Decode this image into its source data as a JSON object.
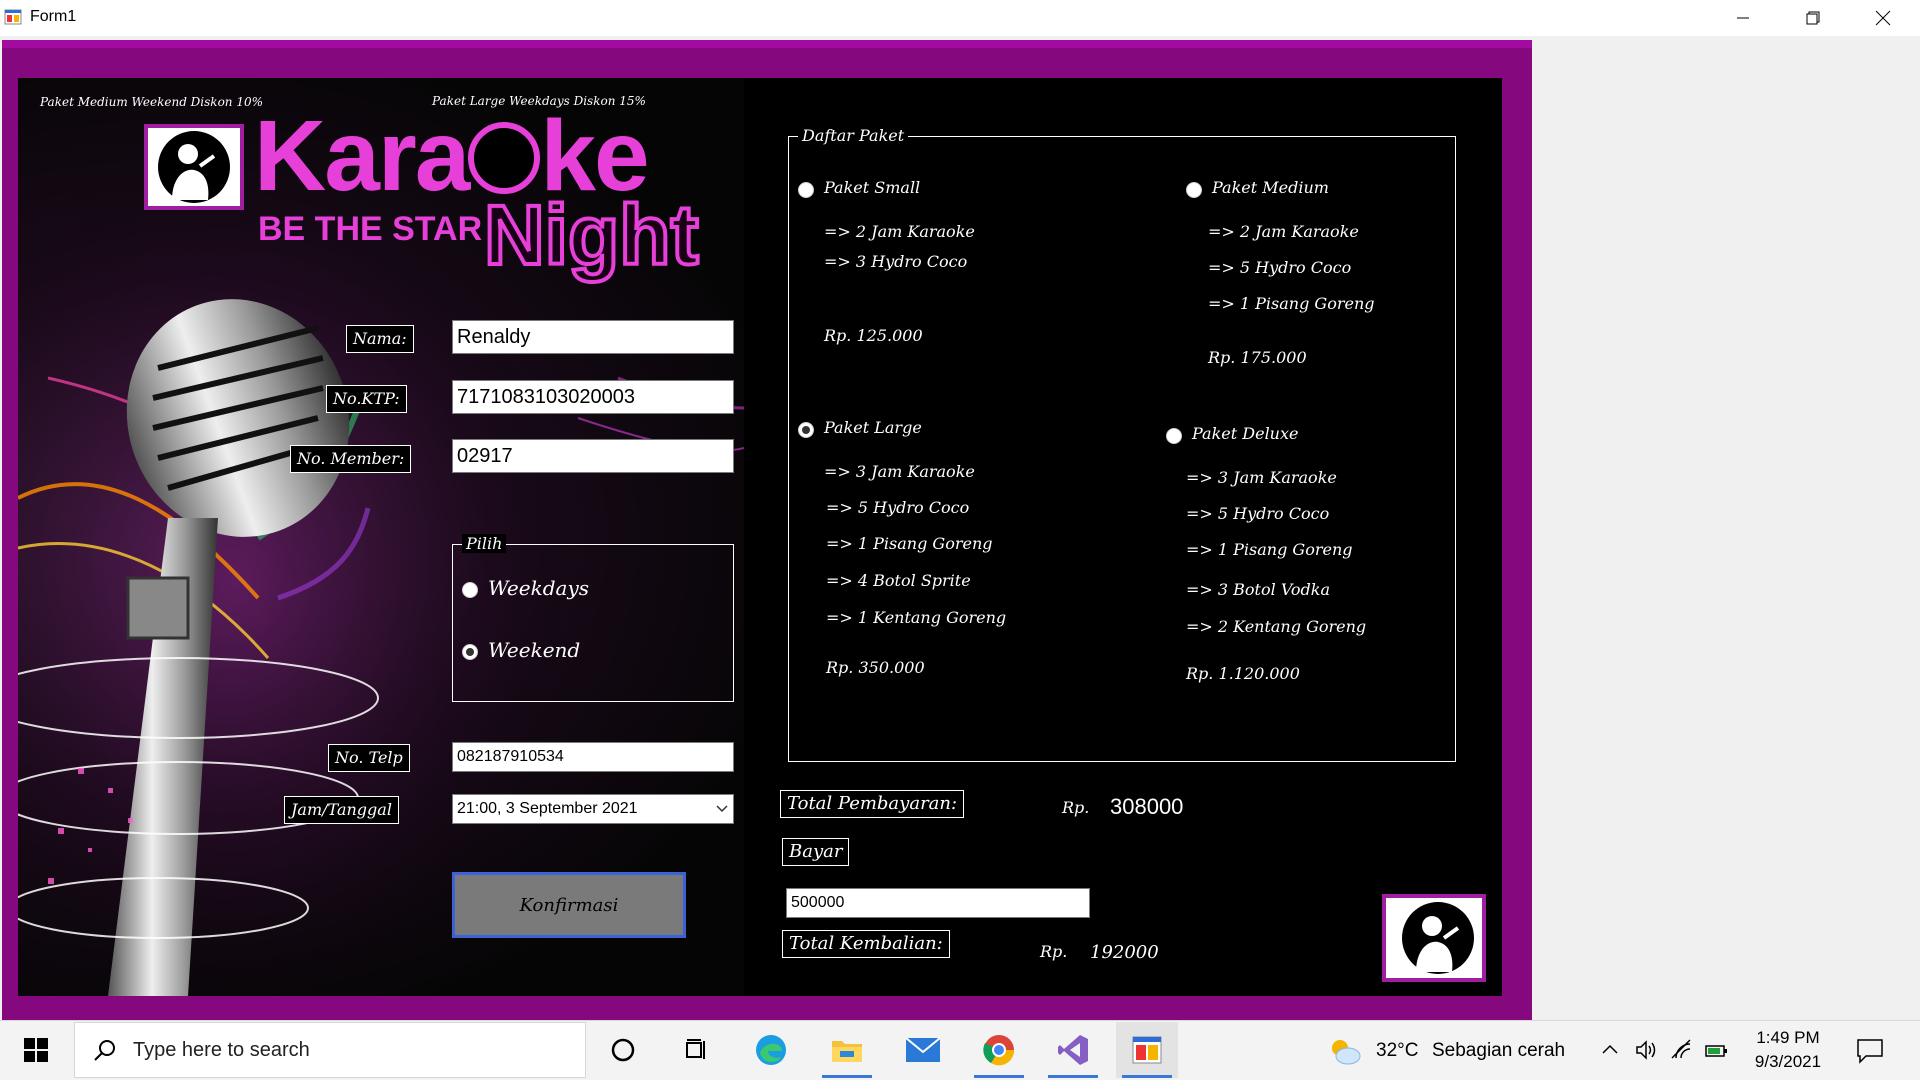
{
  "window": {
    "title": "Form1",
    "app_icon": "winforms-icon",
    "minimize_icon": "minimize-icon",
    "restore_icon": "restore-icon",
    "close_icon": "close-icon"
  },
  "banner": {
    "promo_left": "Paket Medium Weekend Diskon 10%",
    "promo_right": "Paket Large Weekdays Diskon 15%",
    "logo_word_1": "Kara",
    "logo_word_2": "ke",
    "logo_tagline": "BE THE STAR",
    "logo_word_3": "Night",
    "singer_icon": "singer-icon",
    "microphone_art": "microphone-art"
  },
  "form": {
    "nama_label": "Nama:",
    "nama_value": "Renaldy",
    "ktp_label": "No.KTP:",
    "ktp_value": "7171083103020003",
    "member_label": "No. Member:",
    "member_value": "02917",
    "pilih": {
      "caption": "Pilih",
      "options": [
        {
          "label": "Weekdays",
          "checked": false
        },
        {
          "label": "Weekend",
          "checked": true
        }
      ]
    },
    "telp_label": "No. Telp",
    "telp_value": "082187910534",
    "jam_label": "Jam/Tanggal",
    "jam_value": "21:00, 3 September 2021",
    "confirm_button": "Konfirmasi"
  },
  "paket": {
    "caption": "Daftar Paket",
    "small": {
      "label": "Paket Small",
      "checked": false,
      "items": [
        "=> 2 Jam Karaoke",
        "=> 3 Hydro Coco"
      ],
      "price": "Rp. 125.000"
    },
    "medium": {
      "label": "Paket Medium",
      "checked": false,
      "items": [
        "=> 2 Jam Karaoke",
        "=> 5 Hydro Coco",
        "=> 1 Pisang Goreng"
      ],
      "price": "Rp. 175.000"
    },
    "large": {
      "label": "Paket Large",
      "checked": true,
      "items": [
        "=> 3 Jam Karaoke",
        "=> 5 Hydro Coco",
        "=> 1 Pisang Goreng",
        "=> 4 Botol Sprite",
        "=> 1 Kentang Goreng"
      ],
      "price": "Rp. 350.000"
    },
    "deluxe": {
      "label": "Paket Deluxe",
      "checked": false,
      "items": [
        "=> 3 Jam Karaoke",
        "=> 5 Hydro Coco",
        "=> 1 Pisang Goreng",
        "=> 3 Botol Vodka",
        "=> 2 Kentang Goreng"
      ],
      "price": "Rp. 1.120.000"
    }
  },
  "payment": {
    "total_label": "Total Pembayaran:",
    "total_currency": "Rp.",
    "total_value": "308000",
    "bayar_label": "Bayar",
    "bayar_value": "500000",
    "kembalian_label": "Total Kembalian:",
    "kembalian_currency": "Rp.",
    "kembalian_value": "192000"
  },
  "taskbar": {
    "search_placeholder": "Type here to search",
    "weather_temp": "32°C",
    "weather_desc": "Sebagian cerah",
    "time": "1:49 PM",
    "date": "9/3/2021",
    "accent": "#3b78d6"
  }
}
